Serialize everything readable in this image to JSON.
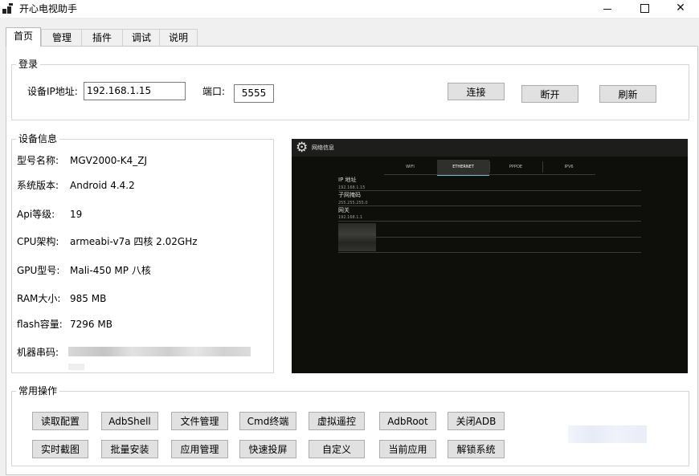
{
  "window": {
    "title": "开心电视助手",
    "minimize_icon": "minimize-icon",
    "maximize_icon": "maximize-icon",
    "close_glyph": "✕"
  },
  "tabs": [
    {
      "label": "首页",
      "active": true
    },
    {
      "label": "管理",
      "active": false
    },
    {
      "label": "插件",
      "active": false
    },
    {
      "label": "调试",
      "active": false
    },
    {
      "label": "说明",
      "active": false
    }
  ],
  "login": {
    "group_title": "登录",
    "ip_label": "设备IP地址:",
    "ip_value": "192.168.1.15",
    "port_label": "端口:",
    "port_value": "5555",
    "connect_label": "连接",
    "disconnect_label": "断开",
    "refresh_label": "刷新"
  },
  "device_info": {
    "group_title": "设备信息",
    "rows": [
      {
        "label": "型号名称:",
        "value": "MGV2000-K4_ZJ"
      },
      {
        "label": "系统版本:",
        "value": "Android 4.4.2"
      },
      {
        "label": "Api等级:",
        "value": "19"
      },
      {
        "label": "CPU架构:",
        "value": "armeabi-v7a 四核 2.02GHz"
      },
      {
        "label": "GPU型号:",
        "value": "Mali-450 MP 八核"
      },
      {
        "label": "RAM大小:",
        "value": "985 MB"
      },
      {
        "label": "flash容量:",
        "value": "7296 MB"
      },
      {
        "label": "机器串码:",
        "value": ""
      }
    ]
  },
  "screen": {
    "title": "网络信息",
    "gear_icon": "settings-gear-icon",
    "tabs": [
      "WIFI",
      "ETHERNET",
      "PPPOE",
      "IPV6"
    ],
    "active_tab": "ETHERNET",
    "fields": [
      {
        "label": "IP 地址",
        "value": "192.168.1.15"
      },
      {
        "label": "子网掩码",
        "value": "255.255.255.0"
      },
      {
        "label": "网关",
        "value": "192.168.1.1"
      }
    ]
  },
  "operations": {
    "group_title": "常用操作",
    "row1": [
      "读取配置",
      "AdbShell",
      "文件管理",
      "Cmd终端",
      "虚拟遥控",
      "AdbRoot",
      "关闭ADB"
    ],
    "row2": [
      "实时截图",
      "批量安装",
      "应用管理",
      "快速投屏",
      "自定义",
      "当前应用",
      "解锁系统"
    ]
  },
  "colors": {
    "window_bg": "#f0f0f0",
    "panel_bg": "#ffffff",
    "button_bg": "#e1e1e1",
    "button_border": "#adadad",
    "screen_bg": "#0e0e0b",
    "screen_accent": "#5bc3d8"
  }
}
